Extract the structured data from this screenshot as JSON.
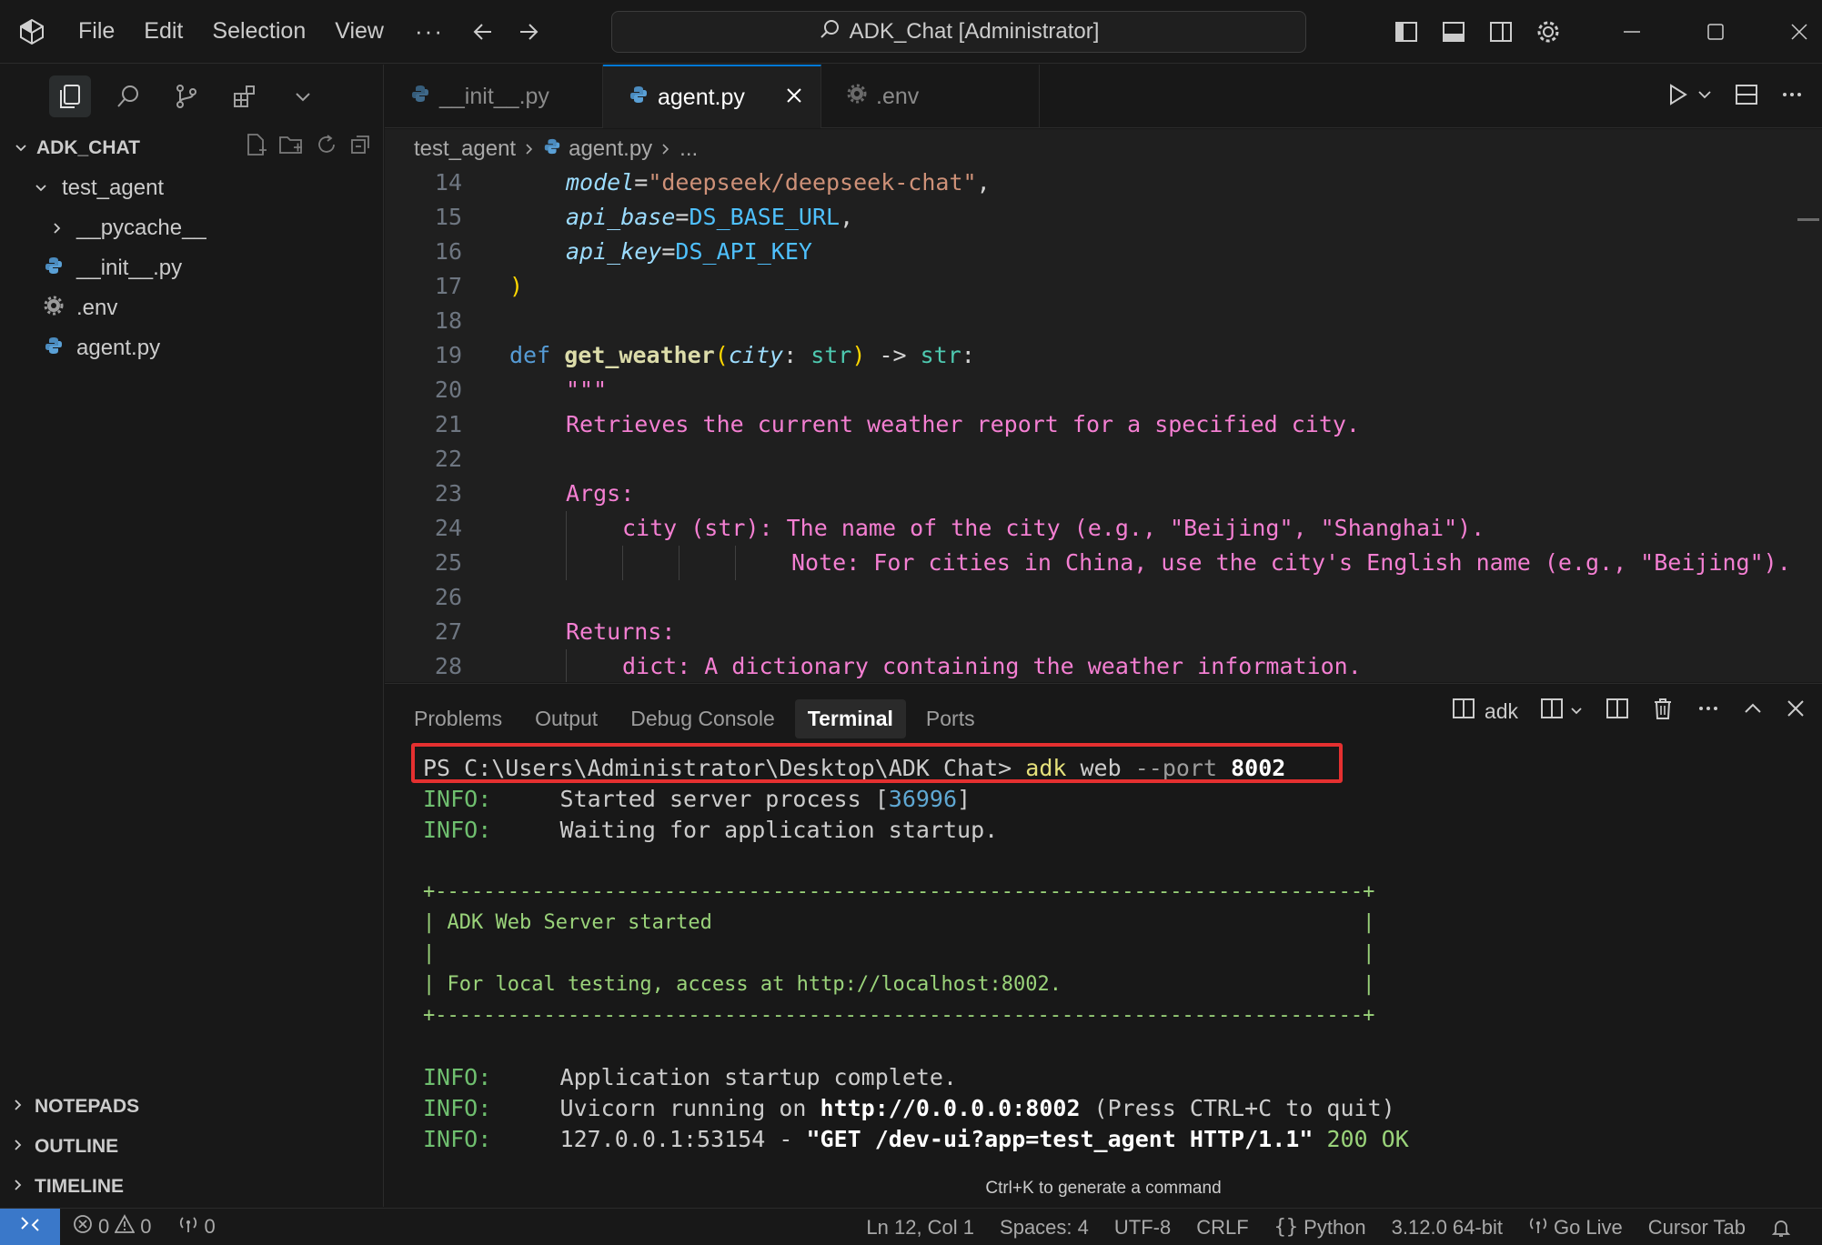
{
  "titlebar": {
    "menu": [
      "File",
      "Edit",
      "Selection",
      "View"
    ],
    "more": "···",
    "search_text": "ADK_Chat [Administrator]"
  },
  "explorer": {
    "title": "ADK_CHAT",
    "tree": [
      {
        "label": "test_agent",
        "kind": "folder-open",
        "depth": 1
      },
      {
        "label": "__pycache__",
        "kind": "folder-closed",
        "depth": 2
      },
      {
        "label": "__init__.py",
        "kind": "python-file",
        "depth": 2
      },
      {
        "label": ".env",
        "kind": "gear-file",
        "depth": 2
      },
      {
        "label": "agent.py",
        "kind": "python-file",
        "depth": 2
      }
    ],
    "sections": [
      "NOTEPADS",
      "OUTLINE",
      "TIMELINE"
    ]
  },
  "tabs": [
    {
      "label": "__init__.py",
      "icon": "python-icon",
      "active": false
    },
    {
      "label": "agent.py",
      "icon": "python-icon",
      "active": true
    },
    {
      "label": ".env",
      "icon": "gear-icon",
      "active": false
    }
  ],
  "breadcrumb": [
    "test_agent",
    "agent.py",
    "..."
  ],
  "code": {
    "lines": [
      {
        "n": "14",
        "indent": 1,
        "html": "<span class=\"param\">model</span><span class=\"pun\">=</span><span class=\"str\">\"deepseek/deepseek-chat\"</span><span class=\"pun\">,</span>"
      },
      {
        "n": "15",
        "indent": 1,
        "html": "<span class=\"param\">api_base</span><span class=\"pun\">=</span><span class=\"const\">DS_BASE_URL</span><span class=\"pun\">,</span>"
      },
      {
        "n": "16",
        "indent": 1,
        "html": "<span class=\"param\">api_key</span><span class=\"pun\">=</span><span class=\"const\">DS_API_KEY</span>"
      },
      {
        "n": "17",
        "indent": 0,
        "html": "<span class=\"paren\">)</span>"
      },
      {
        "n": "18",
        "indent": 0,
        "html": ""
      },
      {
        "n": "19",
        "indent": 0,
        "html": "<span class=\"kw\">def</span> <span class=\"fn\">get_weather</span><span class=\"paren\">(</span><span class=\"param\">city</span><span class=\"pun\">: </span><span class=\"typ\">str</span><span class=\"paren\">)</span><span class=\"pun\"> -&gt; </span><span class=\"typ\">str</span><span class=\"pun\">:</span>"
      },
      {
        "n": "20",
        "indent": 1,
        "html": "<span class=\"doc\">\"\"\"</span>"
      },
      {
        "n": "21",
        "indent": 1,
        "html": "<span class=\"doc\">Retrieves the current weather report for a specified city.</span>"
      },
      {
        "n": "22",
        "indent": 1,
        "html": ""
      },
      {
        "n": "23",
        "indent": 1,
        "html": "<span class=\"doc\">Args:</span>"
      },
      {
        "n": "24",
        "indent": 2,
        "html": "<span class=\"doc\">city (str): The name of the city (e.g., \"Beijing\", \"Shanghai\").</span>"
      },
      {
        "n": "25",
        "indent": 5,
        "html": "<span class=\"doc\">Note: For cities in China, use the city's English name (e.g., \"Beijing\").</span>"
      },
      {
        "n": "26",
        "indent": 1,
        "html": ""
      },
      {
        "n": "27",
        "indent": 1,
        "html": "<span class=\"doc\">Returns:</span>"
      },
      {
        "n": "28",
        "indent": 2,
        "html": "<span class=\"doc\">dict: A dictionary containing the weather information.</span>"
      }
    ]
  },
  "panel": {
    "tabs": [
      "Problems",
      "Output",
      "Debug Console",
      "Terminal",
      "Ports"
    ],
    "active_tab": "Terminal",
    "terminal_name": "adk",
    "hint": "Ctrl+K to generate a command"
  },
  "terminal": {
    "prompt": "PS C:\\Users\\Administrator\\Desktop\\ADK_Chat>",
    "cmd": "adk",
    "arg1": "web",
    "flag": "--port",
    "port": "8002",
    "info_label": "INFO:",
    "l1_text": "Started server process [",
    "l1_pid": "36996",
    "l1_end": "]",
    "l2_text": "Waiting for application startup.",
    "box_top": "+-----------------------------------------------------------------------------+",
    "box_l1": "| ADK Web Server started                                                      |",
    "box_l2": "|                                                                             |",
    "box_l3": "| For local testing, access at http://localhost:8002.                         |",
    "box_bottom": "+-----------------------------------------------------------------------------+",
    "l3_text": "Application startup complete.",
    "l4_a": "Uvicorn running on ",
    "l4_url": "http://0.0.0.0:8002",
    "l4_b": " (Press CTRL+C to quit)",
    "l5_a": "127.0.0.1:53154 - ",
    "l5_req": "\"GET /dev-ui?app=test_agent HTTP/1.1\"",
    "l5_sp": " ",
    "l5_code": "200 OK"
  },
  "statusbar": {
    "errors": "0",
    "warnings": "0",
    "ports": "0",
    "position": "Ln 12, Col 1",
    "spaces": "Spaces: 4",
    "encoding": "UTF-8",
    "eol": "CRLF",
    "language": "Python",
    "interpreter": "3.12.0 64-bit",
    "golive": "Go Live",
    "cursortab": "Cursor Tab"
  },
  "colors": {
    "accent": "#0078d4",
    "highlight_box": "#e53030",
    "remote": "#3a78c9"
  }
}
